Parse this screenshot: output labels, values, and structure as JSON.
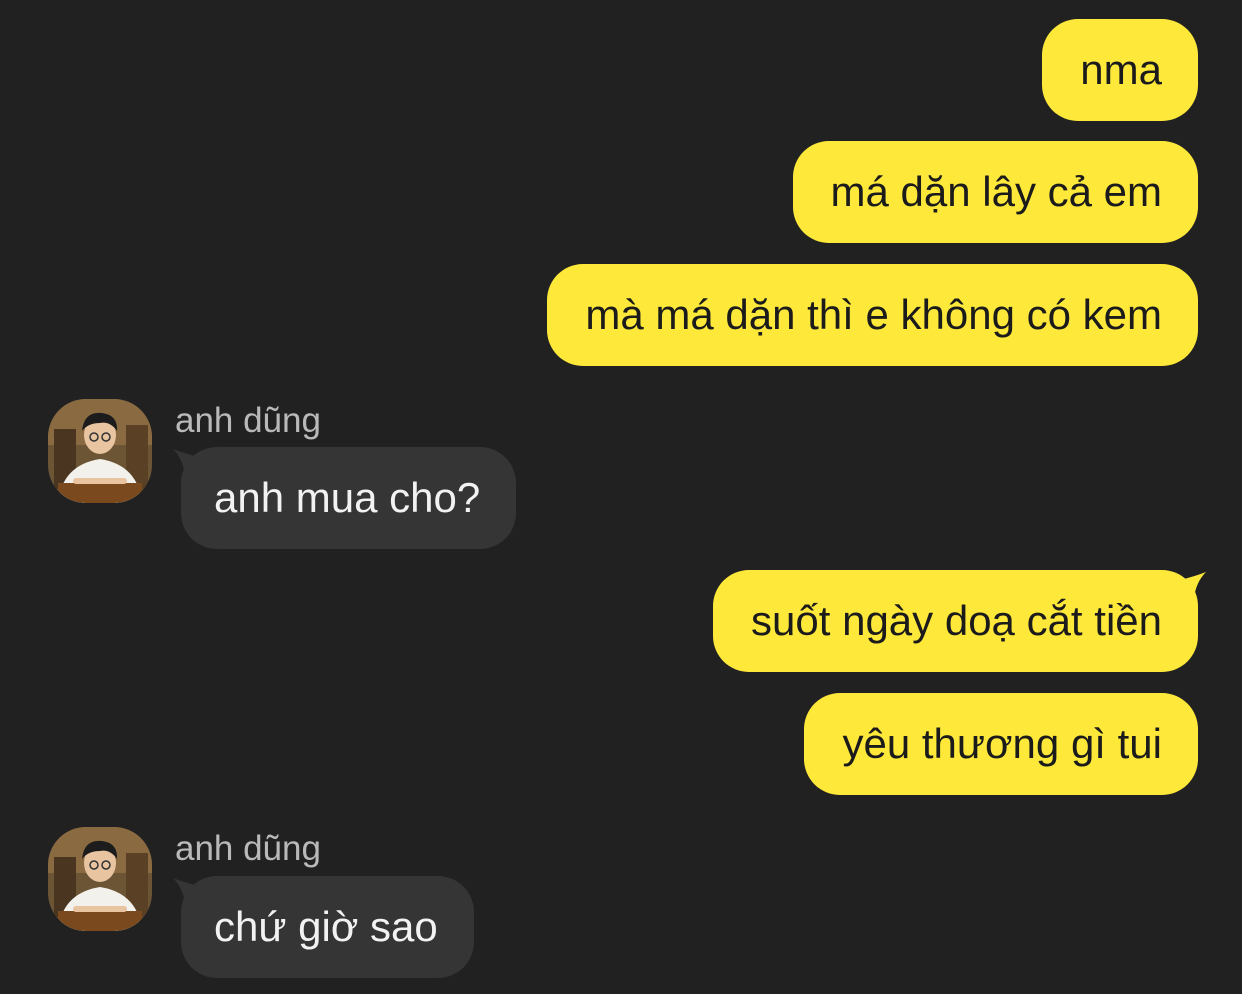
{
  "colors": {
    "background": "#212121",
    "outgoing_bubble": "#fee93a",
    "incoming_bubble": "#353535",
    "sender_name": "#b9b9b9"
  },
  "messages": [
    {
      "direction": "outgoing",
      "text": "nma"
    },
    {
      "direction": "outgoing",
      "text": "má dặn lây cả em"
    },
    {
      "direction": "outgoing",
      "text": "mà má dặn thì e không có kem"
    },
    {
      "direction": "incoming",
      "sender": "anh dũng",
      "avatar_icon": "avatar-photo",
      "text": "anh mua cho?"
    },
    {
      "direction": "outgoing",
      "text": "suốt ngày doạ cắt tiền"
    },
    {
      "direction": "outgoing",
      "text": "yêu thương gì tui"
    },
    {
      "direction": "incoming",
      "sender": "anh dũng",
      "avatar_icon": "avatar-photo",
      "text": "chứ giờ sao"
    }
  ]
}
